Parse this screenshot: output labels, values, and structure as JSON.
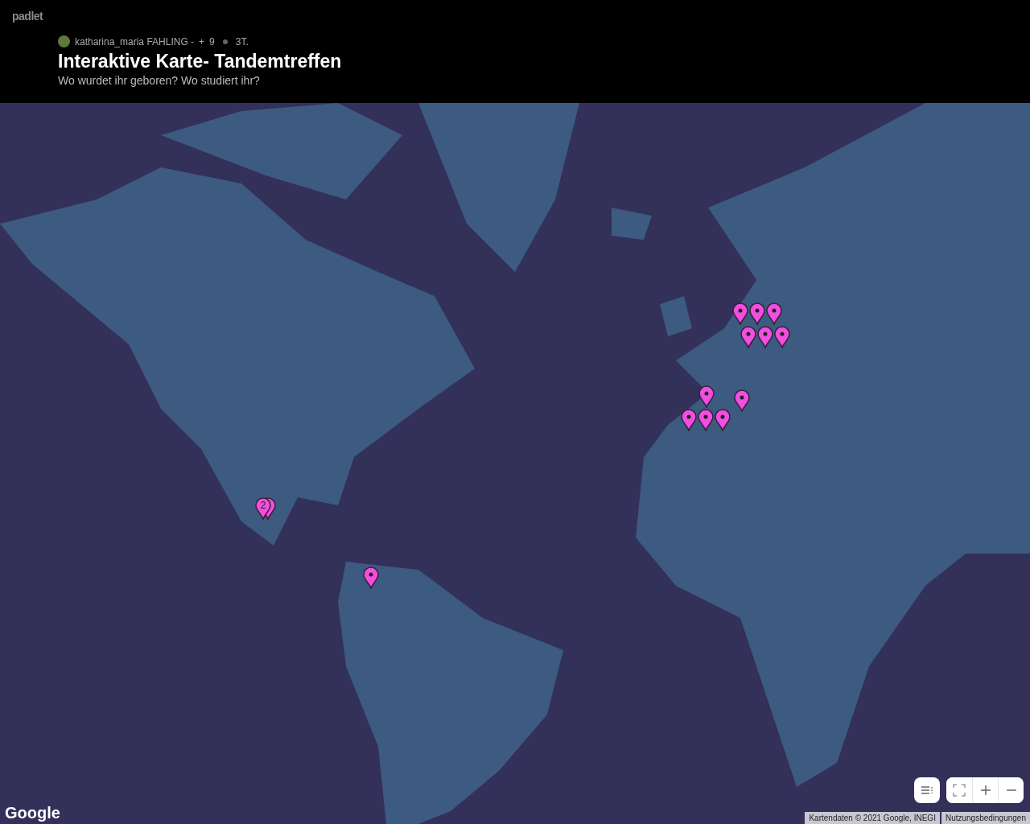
{
  "brand": "padlet",
  "meta": {
    "author": "katharina_maria FAHLING -",
    "plus": "+",
    "count": "9",
    "age": "3T."
  },
  "title": "Interaktive Karte- Tandemtreffen",
  "subtitle": "Wo wurdet ihr geboren? Wo studiert ihr?",
  "pins": [
    {
      "kind": "single"
    },
    {
      "kind": "single"
    },
    {
      "kind": "single"
    },
    {
      "kind": "single"
    },
    {
      "kind": "single"
    },
    {
      "kind": "single"
    },
    {
      "kind": "single"
    },
    {
      "kind": "single"
    },
    {
      "kind": "single"
    },
    {
      "kind": "single"
    },
    {
      "kind": "single"
    },
    {
      "kind": "cluster",
      "count": "2"
    },
    {
      "kind": "single"
    }
  ],
  "map_logo": "Google",
  "attribution": [
    "Kartendaten © 2021 Google, INEGI",
    "Nutzungsbedingungen"
  ]
}
